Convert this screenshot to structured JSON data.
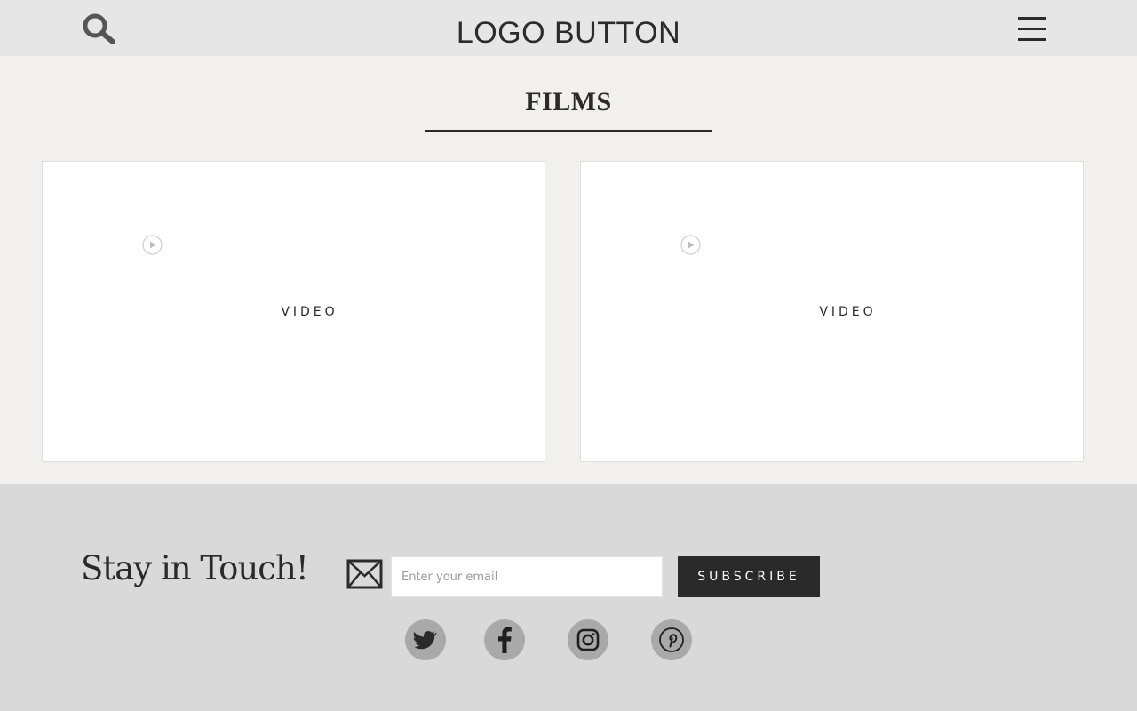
{
  "header": {
    "logo_text": "LOGO BUTTON",
    "search_icon": "search-icon",
    "menu_icon": "hamburger-menu-icon"
  },
  "films": {
    "title": "FILMS",
    "videos": [
      {
        "label": "VIDEO",
        "icon": "play-icon"
      },
      {
        "label": "VIDEO",
        "icon": "play-icon"
      }
    ]
  },
  "footer": {
    "heading": "Stay in Touch!",
    "mail_icon": "envelope-icon",
    "email_placeholder": "Enter your email",
    "email_value": "",
    "subscribe_label": "SUBSCRIBE",
    "social": [
      {
        "name": "twitter",
        "icon": "twitter-icon"
      },
      {
        "name": "facebook",
        "icon": "facebook-icon"
      },
      {
        "name": "instagram",
        "icon": "instagram-icon"
      },
      {
        "name": "pinterest",
        "icon": "pinterest-icon"
      }
    ]
  },
  "colors": {
    "header_bg": "#e7e6e7",
    "page_bg": "#f1f0ee",
    "footer_bg": "#d9d9d9",
    "accent_dark": "#2a2a2a",
    "social_circle": "#a9a9a9"
  }
}
